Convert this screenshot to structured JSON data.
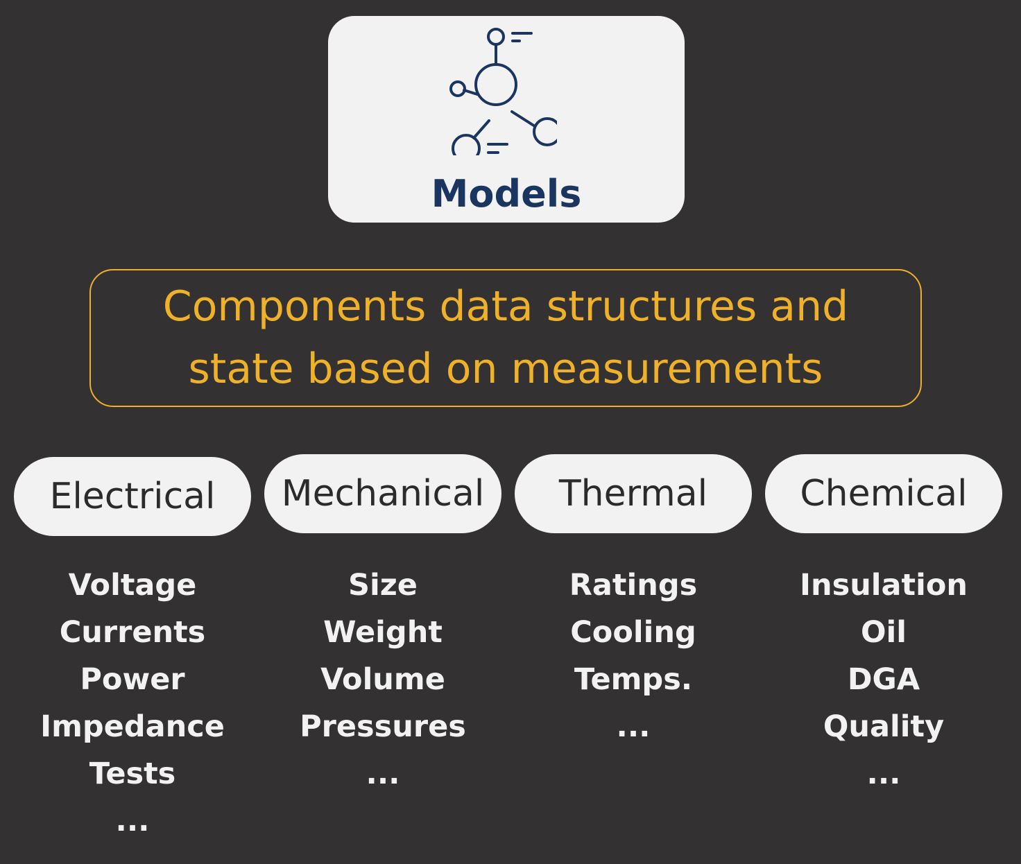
{
  "header": {
    "icon": "molecule-network-icon",
    "title": "Models"
  },
  "description": {
    "line1": "Components data structures and",
    "line2": "state based on measurements"
  },
  "colors": {
    "background": "#333132",
    "card": "#f2f2f2",
    "title": "#1a3560",
    "accent": "#f0b12a",
    "list_text": "#f2f2f2",
    "pill_text": "#2b2b2b"
  },
  "categories": [
    {
      "label": "Electrical",
      "items": [
        "Voltage",
        "Currents",
        "Power",
        "Impedance",
        "Tests",
        "..."
      ]
    },
    {
      "label": "Mechanical",
      "items": [
        "Size",
        "Weight",
        "Volume",
        "Pressures",
        "..."
      ]
    },
    {
      "label": "Thermal",
      "items": [
        "Ratings",
        "Cooling",
        "Temps.",
        "..."
      ]
    },
    {
      "label": "Chemical",
      "items": [
        "Insulation",
        "Oil",
        "DGA",
        "Quality",
        "..."
      ]
    }
  ]
}
